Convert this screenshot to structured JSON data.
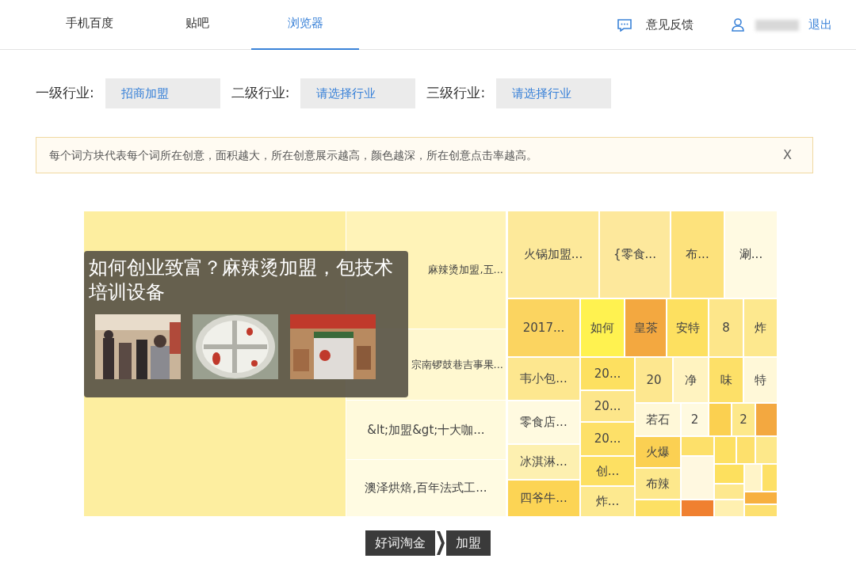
{
  "nav": {
    "tabs": [
      {
        "label": "手机百度",
        "selected": false
      },
      {
        "label": "贴吧",
        "selected": false
      },
      {
        "label": "浏览器",
        "selected": true
      }
    ],
    "feedback": "意见反馈",
    "logout": "退出"
  },
  "filters": [
    {
      "label": "一级行业:",
      "value": "招商加盟"
    },
    {
      "label": "二级行业:",
      "value": "请选择行业"
    },
    {
      "label": "三级行业:",
      "value": "请选择行业"
    }
  ],
  "notice": {
    "text": "每个词方块代表每个词所在创意，面积越大，所在创意展示越高，颜色越深，所在创意点击率越高。",
    "close": "X"
  },
  "treemap": {
    "tiles": [
      {
        "color": "#fdeea0"
      },
      {
        "label": "麻辣烫加盟,五...",
        "color": "#fff3b8"
      },
      {
        "label": "宗南锣鼓巷吉事果...",
        "color": "#fff8d0"
      },
      {
        "label": "&lt;加盟&gt;十大咖...",
        "color": "#fffadc"
      },
      {
        "label": "澳泽烘焙,百年法式工...",
        "color": "#fffbe2"
      },
      {
        "label": "火锅加盟...",
        "color": "#fde99a"
      },
      {
        "label": "{零食...",
        "color": "#fde89c"
      },
      {
        "label": "布...",
        "color": "#fde27c"
      },
      {
        "label": "涮...",
        "color": "#fffae2"
      },
      {
        "label": "2017...",
        "color": "#fbd460"
      },
      {
        "label": "如何",
        "color": "#fff250"
      },
      {
        "label": "皇茶",
        "color": "#f3a840"
      },
      {
        "label": "安特",
        "color": "#fde060"
      },
      {
        "label": "8",
        "color": "#fde68a"
      },
      {
        "label": "炸",
        "color": "#fde88e"
      },
      {
        "label": "韦小包...",
        "color": "#fde78f"
      },
      {
        "label": "零食店...",
        "color": "#fffae0"
      },
      {
        "label": "冰淇淋...",
        "color": "#fdf0b0"
      },
      {
        "label": "四爷牛...",
        "color": "#fcd454"
      },
      {
        "label": "20...",
        "color": "#fde060"
      },
      {
        "label": "20...",
        "color": "#fde68a"
      },
      {
        "label": "20...",
        "color": "#fde068"
      },
      {
        "label": "创...",
        "color": "#fde062"
      },
      {
        "label": "炸...",
        "color": "#fde98f"
      },
      {
        "label": "20",
        "color": "#fde78f"
      },
      {
        "label": "净",
        "color": "#fff3c0"
      },
      {
        "label": "味",
        "color": "#fde068"
      },
      {
        "label": "特",
        "color": "#fff8d8"
      },
      {
        "label": "若石",
        "color": "#fff8d8"
      },
      {
        "label": "2",
        "color": "#fffae0"
      },
      {
        "color": "#fbd050"
      },
      {
        "label": "2",
        "color": "#fde88a"
      },
      {
        "color": "#f3a840"
      },
      {
        "label": "火爆",
        "color": "#fbd052"
      },
      {
        "label": "布辣",
        "color": "#fde88c"
      },
      {
        "color": "#fde064"
      },
      {
        "color": "#fde06a"
      },
      {
        "color": "#fff8e0"
      },
      {
        "color": "#f08030"
      },
      {
        "color": "#fde062"
      },
      {
        "color": "#fde06c"
      },
      {
        "color": "#fde88a"
      },
      {
        "color": "#fde05e"
      },
      {
        "color": "#fde88e"
      },
      {
        "color": "#fff4c8"
      },
      {
        "color": "#fde066"
      },
      {
        "color": "#f7b040"
      },
      {
        "color": "#fde070"
      },
      {
        "color": "#fff0b0"
      }
    ],
    "tooltip": {
      "title": "如何创业致富？麻辣烫加盟，包技术培训设备"
    }
  },
  "breadcrumb": [
    {
      "label": "好词淘金"
    },
    {
      "label": "加盟"
    }
  ]
}
